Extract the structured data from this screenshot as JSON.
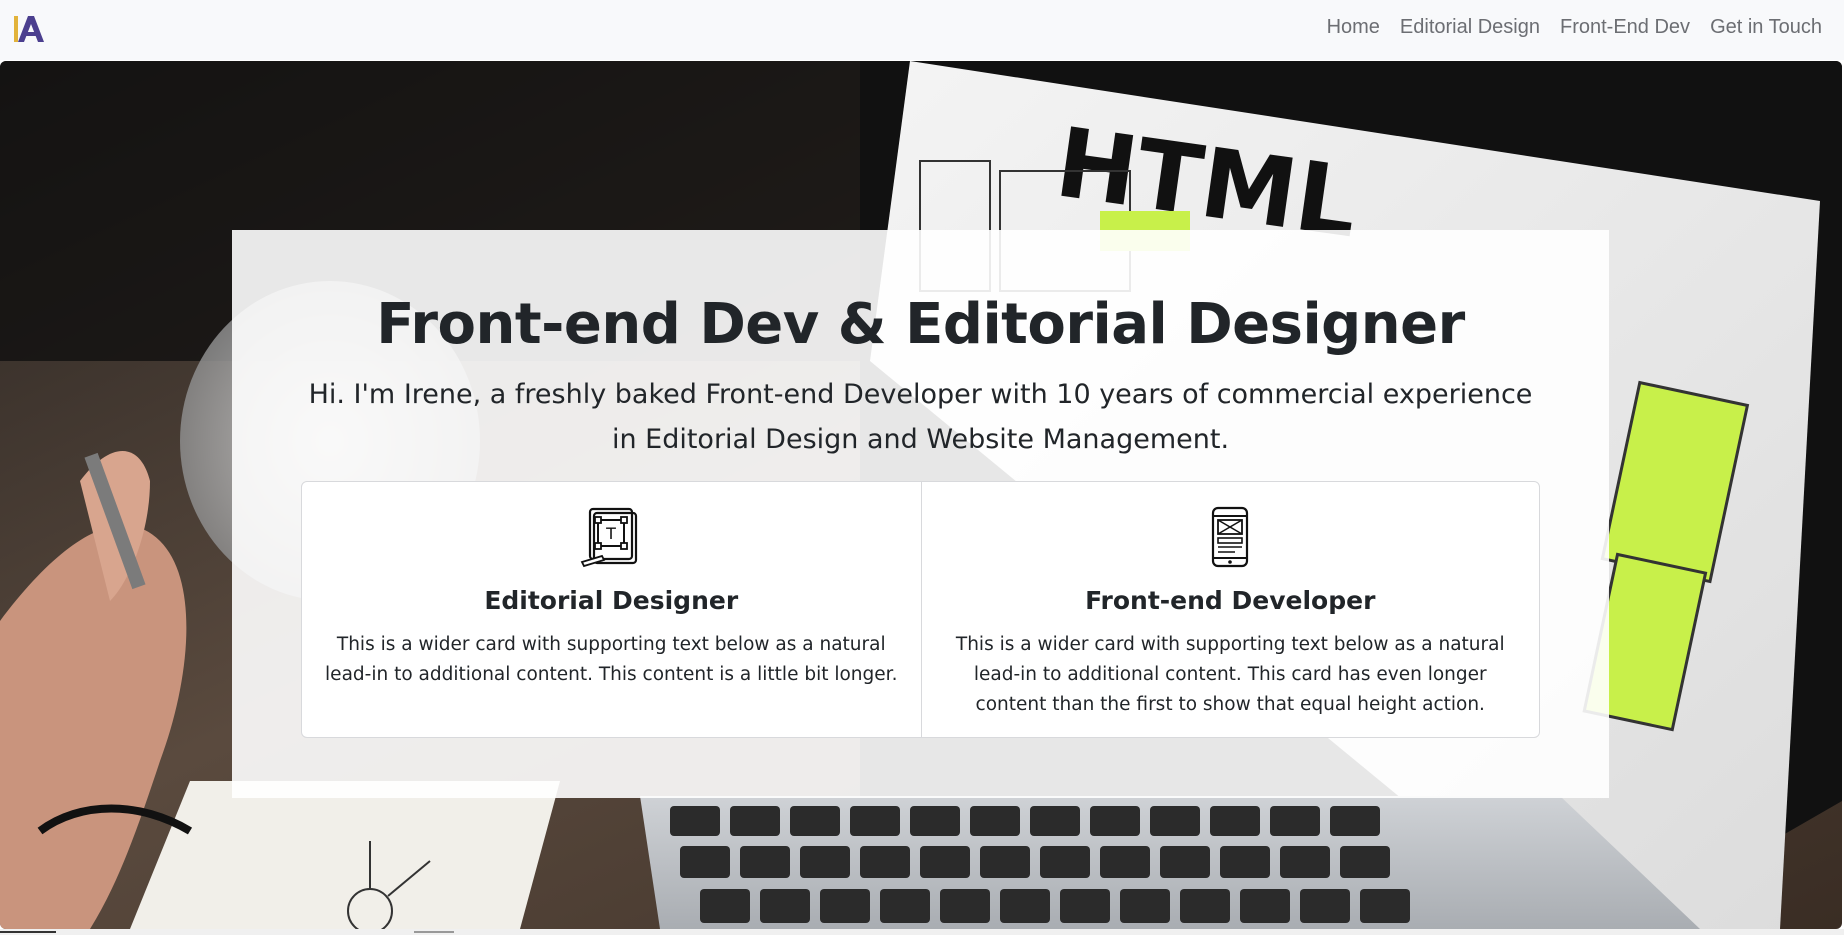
{
  "nav": {
    "logo_letter": "A",
    "links": [
      "Home",
      "Editorial Design",
      "Front-End Dev",
      "Get in Touch"
    ]
  },
  "hero": {
    "headline": "Front-end Dev & Editorial Designer",
    "intro": "Hi. I'm Irene, a freshly baked Front-end Developer with 10 years of commercial experience in Editorial Design and Website Management.",
    "background_icon": "laptop-html-wireframe-photo",
    "screen_text": "HTML"
  },
  "cards": [
    {
      "icon": "typography-document-icon",
      "title": "Editorial Designer",
      "text": "This is a wider card with supporting text below as a natural lead-in to additional content. This content is a little bit longer."
    },
    {
      "icon": "mobile-wireframe-icon",
      "title": "Front-end Developer",
      "text": "This is a wider card with supporting text below as a natural lead-in to additional content. This card has even longer content than the first to show that equal height action."
    }
  ],
  "colors": {
    "nav_bg": "#f8f9fb",
    "nav_link": "#6c6e73",
    "text": "#212529",
    "logo_purple": "#4b3f8f",
    "logo_gold": "#e2b33b",
    "accent_green": "#c8f04a"
  }
}
